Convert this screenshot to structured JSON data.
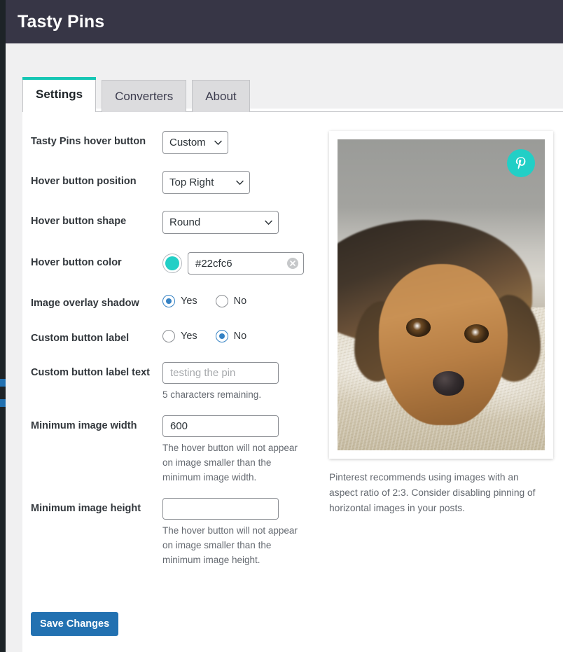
{
  "header": {
    "title": "Tasty Pins"
  },
  "tabs": [
    {
      "label": "Settings",
      "active": true
    },
    {
      "label": "Converters",
      "active": false
    },
    {
      "label": "About",
      "active": false
    }
  ],
  "settings": {
    "hover_button": {
      "label": "Tasty Pins hover button",
      "value": "Custom",
      "options": [
        "Custom"
      ]
    },
    "hover_position": {
      "label": "Hover button position",
      "value": "Top Right",
      "options": [
        "Top Right"
      ]
    },
    "hover_shape": {
      "label": "Hover button shape",
      "value": "Round",
      "options": [
        "Round"
      ]
    },
    "hover_color": {
      "label": "Hover button color",
      "value": "#22cfc6",
      "swatch_color": "#22cfc6"
    },
    "overlay_shadow": {
      "label": "Image overlay shadow",
      "yes_label": "Yes",
      "no_label": "No",
      "selected": "Yes"
    },
    "custom_button_label": {
      "label": "Custom button label",
      "yes_label": "Yes",
      "no_label": "No",
      "selected": "No"
    },
    "custom_button_label_text": {
      "label": "Custom button label text",
      "value": "",
      "placeholder": "testing the pin",
      "counter": "5 characters remaining."
    },
    "min_image_width": {
      "label": "Minimum image width",
      "value": "600",
      "help": "The hover button will not appear on image smaller than the minimum image width."
    },
    "min_image_height": {
      "label": "Minimum image height",
      "value": "",
      "help": "The hover button will not appear on image smaller than the minimum image height."
    },
    "save_label": "Save Changes"
  },
  "preview": {
    "badge_color": "#22cfc6",
    "caption": "Pinterest recommends using images with an aspect ratio of 2:3. Consider disabling pinning of horizontal images in your posts."
  },
  "colors": {
    "header_bg": "#373646",
    "accent_teal": "#16c6b4",
    "primary_blue": "#2271b1",
    "radio_blue": "#3582c4",
    "rail_dark": "#1d2327"
  }
}
